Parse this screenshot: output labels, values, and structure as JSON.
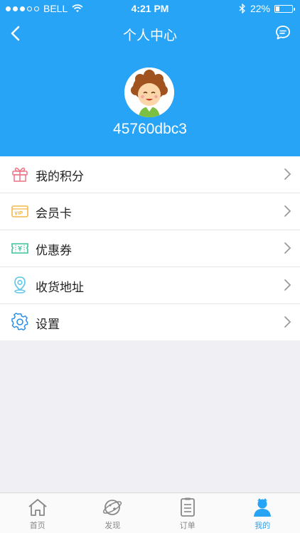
{
  "status_bar": {
    "carrier": "BELL",
    "time": "4:21 PM",
    "battery": "22%",
    "battery_level": 0.22
  },
  "navbar": {
    "title": "个人中心",
    "back_icon": "chevron-left-icon",
    "chat_icon": "chat-bubble-icon"
  },
  "profile": {
    "username": "45760dbc3"
  },
  "menu": {
    "items": [
      {
        "label": "我的积分",
        "icon": "gift-icon",
        "color": "#f07a8c"
      },
      {
        "label": "会员卡",
        "icon": "vip-card-icon",
        "color": "#f3b84b"
      },
      {
        "label": "优惠券",
        "icon": "coupon-icon",
        "color": "#3cc49a"
      },
      {
        "label": "收货地址",
        "icon": "location-pin-icon",
        "color": "#5bc6e6"
      },
      {
        "label": "设置",
        "icon": "gear-icon",
        "color": "#2a8ee6"
      }
    ]
  },
  "tabbar": {
    "tabs": [
      {
        "label": "首页",
        "icon": "home-icon"
      },
      {
        "label": "发现",
        "icon": "planet-icon"
      },
      {
        "label": "订单",
        "icon": "order-list-icon"
      },
      {
        "label": "我的",
        "icon": "user-icon",
        "active": true
      }
    ],
    "accent": "#27a4f6"
  }
}
